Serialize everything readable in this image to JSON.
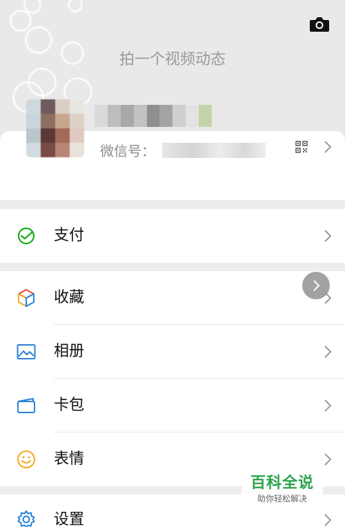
{
  "header": {
    "moments_hint": "拍一个视频动态",
    "camera_icon": "camera-icon"
  },
  "profile": {
    "wechat_id_label": "微信号：",
    "wechat_id_value": "",
    "qr_icon": "qr-code-icon"
  },
  "menu": {
    "pay": {
      "label": "支付",
      "icon": "wechat-pay-icon",
      "color": "#1aad19"
    },
    "favorites": {
      "label": "收藏",
      "icon": "favorites-cube-icon"
    },
    "album": {
      "label": "相册",
      "icon": "album-image-icon",
      "color": "#2782d7"
    },
    "cards": {
      "label": "卡包",
      "icon": "card-wallet-icon",
      "color": "#2782d7"
    },
    "stickers": {
      "label": "表情",
      "icon": "sticker-smile-icon",
      "color": "#f5a623"
    },
    "settings": {
      "label": "设置",
      "icon": "settings-gear-icon",
      "color": "#2782d7"
    }
  },
  "watermark": {
    "title": "百科全说",
    "subtitle": "助你轻松解决"
  }
}
